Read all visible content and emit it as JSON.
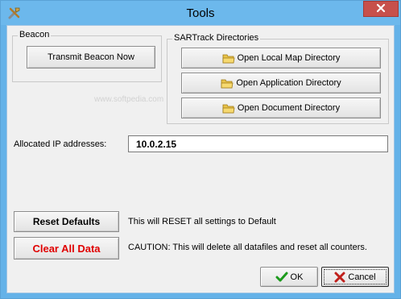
{
  "window": {
    "title": "Tools"
  },
  "beacon": {
    "group_label": "Beacon",
    "transmit_label": "Transmit Beacon Now"
  },
  "directories": {
    "group_label": "SARTrack Directories",
    "local_map_label": "Open Local Map Directory",
    "application_label": "Open Application Directory",
    "document_label": "Open Document Directory"
  },
  "ip": {
    "label": "Allocated IP addresses:",
    "value": "10.0.2.15"
  },
  "reset": {
    "button_label": "Reset Defaults",
    "description": "This will RESET all settings to Default"
  },
  "clear": {
    "button_label": "Clear All Data",
    "description": "CAUTION: This will delete all datafiles and reset all counters."
  },
  "footer": {
    "ok_label": "OK",
    "cancel_label": "Cancel"
  },
  "watermark": "www.softpedia.com",
  "colors": {
    "titlebar": "#6cb8ec",
    "close": "#c7504b",
    "danger_text": "#e00000",
    "ok_check": "#1c9a1c",
    "cancel_x": "#c0201c"
  },
  "icons": [
    "tools-icon",
    "close-icon",
    "folder-icon",
    "check-icon",
    "x-icon"
  ]
}
